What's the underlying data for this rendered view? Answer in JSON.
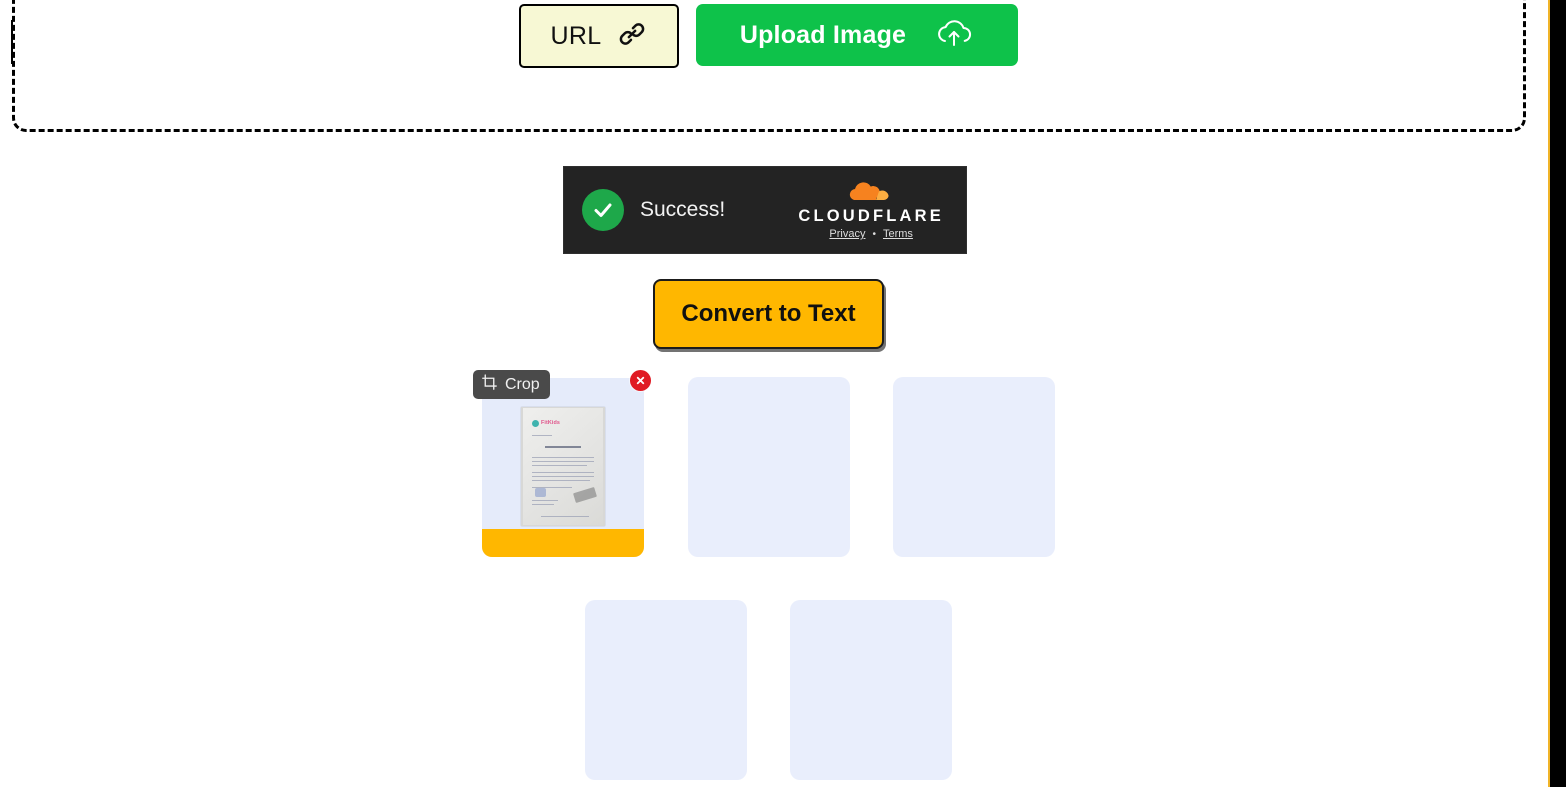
{
  "dropzone": {
    "name": "image-dropzone"
  },
  "top_actions": {
    "url_button": {
      "label": "URL",
      "icon": "link-icon",
      "bg": "#f7f8d4"
    },
    "upload_button": {
      "label": "Upload Image",
      "icon": "cloud-upload-icon",
      "bg": "#0ec24a"
    }
  },
  "turnstile": {
    "status": "Success!",
    "brand": "CLOUDFLARE",
    "privacy_link": "Privacy",
    "separator": "•",
    "terms_link": "Terms",
    "bg": "#232323",
    "check_color": "#1ea84a"
  },
  "convert": {
    "label": "Convert to Text",
    "bg": "#ffb700"
  },
  "thumbnails": {
    "crop_tooltip": {
      "label": "Crop",
      "icon": "crop-icon"
    },
    "remove_button": {
      "icon": "close-icon",
      "color": "#e01b24"
    },
    "placeholder_color": "#e9eefc",
    "progress_color": "#ffb700",
    "cards": [
      {
        "id": "card-0",
        "state": "uploaded",
        "doc_logo_text": "FitKids"
      },
      {
        "id": "card-1",
        "state": "empty"
      },
      {
        "id": "card-2",
        "state": "empty"
      },
      {
        "id": "card-3",
        "state": "empty"
      },
      {
        "id": "card-4",
        "state": "empty"
      }
    ]
  },
  "scrollbar": {
    "thumb_color": "#000000",
    "accent_color": "#f0b429"
  }
}
